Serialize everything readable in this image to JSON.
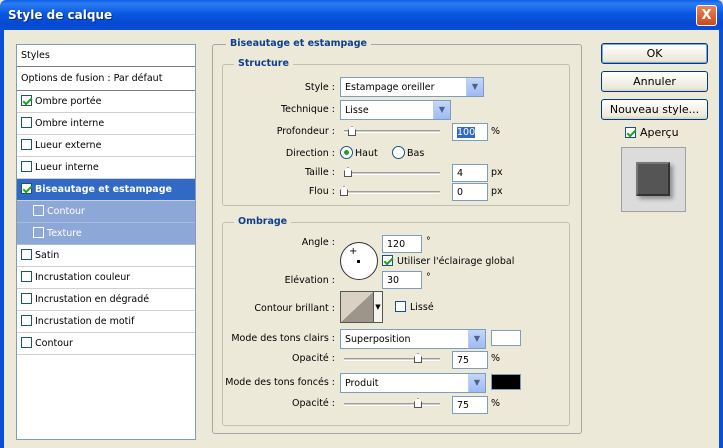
{
  "window": {
    "title": "Style de calque",
    "close": "X"
  },
  "sidebar": {
    "header": "Styles",
    "fusion": "Options de fusion : Par défaut",
    "items": [
      {
        "label": "Ombre portée",
        "checked": true
      },
      {
        "label": "Ombre interne",
        "checked": false
      },
      {
        "label": "Lueur externe",
        "checked": false
      },
      {
        "label": "Lueur interne",
        "checked": false
      },
      {
        "label": "Biseautage et estampage",
        "checked": true
      },
      {
        "label": "Contour",
        "checked": false
      },
      {
        "label": "Texture",
        "checked": false
      },
      {
        "label": "Satin",
        "checked": false
      },
      {
        "label": "Incrustation couleur",
        "checked": false
      },
      {
        "label": "Incrustation en dégradé",
        "checked": false
      },
      {
        "label": "Incrustation de motif",
        "checked": false
      },
      {
        "label": "Contour",
        "checked": false
      }
    ]
  },
  "panel": {
    "title": "Biseautage et estampage",
    "structure": {
      "title": "Structure",
      "style_label": "Style :",
      "style_value": "Estampage oreiller",
      "technique_label": "Technique :",
      "technique_value": "Lisse",
      "depth_label": "Profondeur :",
      "depth_value": "100",
      "depth_unit": "%",
      "direction_label": "Direction :",
      "dir_up": "Haut",
      "dir_down": "Bas",
      "size_label": "Taille :",
      "size_value": "4",
      "size_unit": "px",
      "blur_label": "Flou :",
      "blur_value": "0",
      "blur_unit": "px"
    },
    "shading": {
      "title": "Ombrage",
      "angle_label": "Angle :",
      "angle_value": "120",
      "angle_unit": "°",
      "global_light": "Utiliser l'éclairage global",
      "altitude_label": "Elévation :",
      "altitude_value": "30",
      "altitude_unit": "°",
      "gloss_label": "Contour brillant :",
      "smooth_label": "Lissé",
      "highlight_mode_label": "Mode des tons clairs :",
      "highlight_mode_value": "Superposition",
      "highlight_color": "#ffffff",
      "highlight_opacity_label": "Opacité :",
      "highlight_opacity_value": "75",
      "highlight_opacity_unit": "%",
      "shadow_mode_label": "Mode des tons foncés :",
      "shadow_mode_value": "Produit",
      "shadow_color": "#000000",
      "shadow_opacity_label": "Opacité :",
      "shadow_opacity_value": "75",
      "shadow_opacity_unit": "%"
    }
  },
  "buttons": {
    "ok": "OK",
    "cancel": "Annuler",
    "new_style": "Nouveau style...",
    "preview": "Aperçu"
  }
}
